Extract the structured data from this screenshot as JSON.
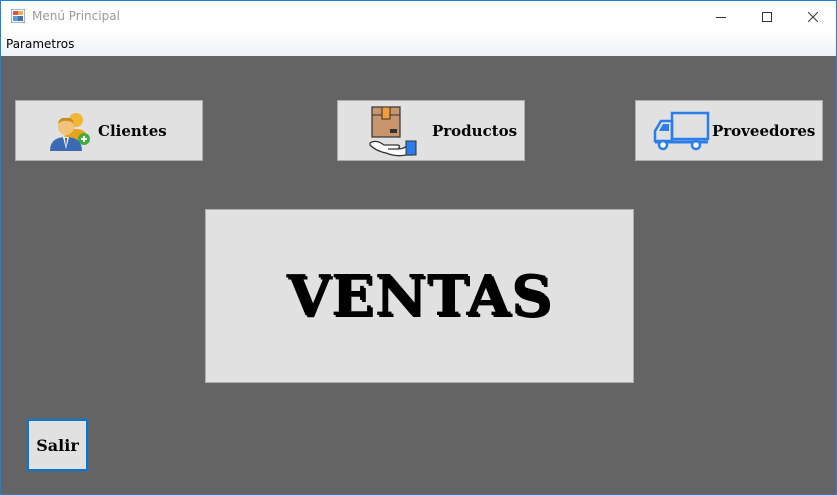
{
  "window": {
    "title": "Menú Principal"
  },
  "menubar": {
    "items": [
      {
        "label": "Parametros"
      }
    ]
  },
  "buttons": {
    "clientes": {
      "label": "Clientes",
      "icon": "users-icon"
    },
    "productos": {
      "label": "Productos",
      "icon": "box-hand-icon"
    },
    "proveedores": {
      "label": "Proveedores",
      "icon": "truck-icon"
    },
    "ventas": {
      "label": "VENTAS"
    },
    "salir": {
      "label": "Salir"
    }
  },
  "colors": {
    "background": "#646464",
    "button_face": "#e1e1e1",
    "accent": "#0078d7",
    "truck_blue": "#2b7de9"
  }
}
